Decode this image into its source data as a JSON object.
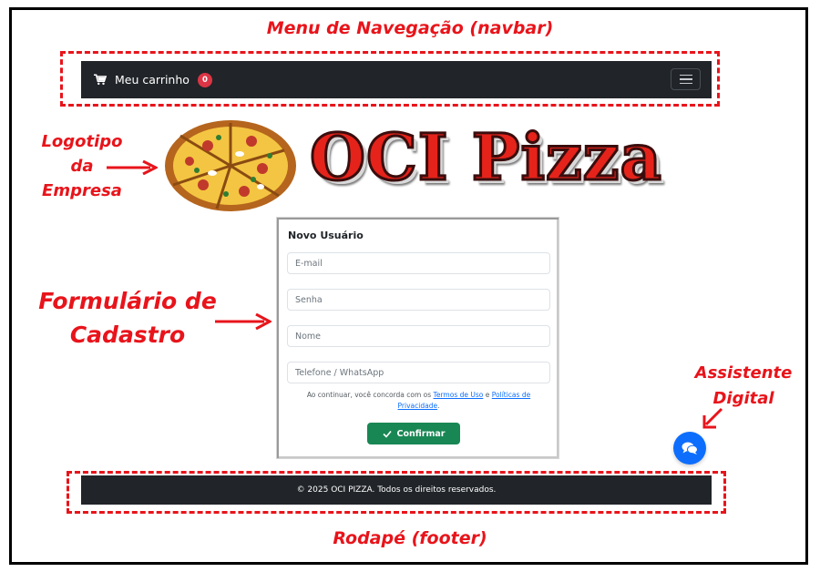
{
  "annotations": {
    "navbar": "Menu de Navegação (navbar)",
    "logo": [
      "Logotipo",
      "da",
      "Empresa"
    ],
    "form": [
      "Formulário de",
      "Cadastro"
    ],
    "assistant": [
      "Assistente",
      "Digital"
    ],
    "footer": "Rodapé (footer)"
  },
  "navbar": {
    "cart_label": "Meu carrinho",
    "cart_count": "0",
    "cart_icon": "shopping-cart-icon",
    "toggler_icon": "hamburger-menu-icon"
  },
  "logo": {
    "text": "OCI Pizza",
    "image": "pizza-logo-image"
  },
  "form": {
    "title": "Novo Usuário",
    "email_placeholder": "E-mail",
    "password_placeholder": "Senha",
    "name_placeholder": "Nome",
    "phone_placeholder": "Telefone / WhatsApp",
    "terms_prefix": "Ao continuar, você concorda com os",
    "terms_link": "Termos de Uso",
    "terms_and": "e",
    "privacy_link": "Políticas de Privacidade",
    "terms_suffix": ".",
    "confirm_label": "Confirmar",
    "confirm_icon": "check-icon"
  },
  "chat": {
    "icon": "chat-bubbles-icon"
  },
  "footer": {
    "text": "© 2025 OCI PIZZA. Todos os direitos reservados."
  },
  "colors": {
    "annotation_red": "#e8141b",
    "navbar_bg": "#212529",
    "badge_red": "#dc3545",
    "confirm_green": "#198754",
    "chat_blue": "#0d6efd",
    "link_blue": "#0d6efd"
  }
}
